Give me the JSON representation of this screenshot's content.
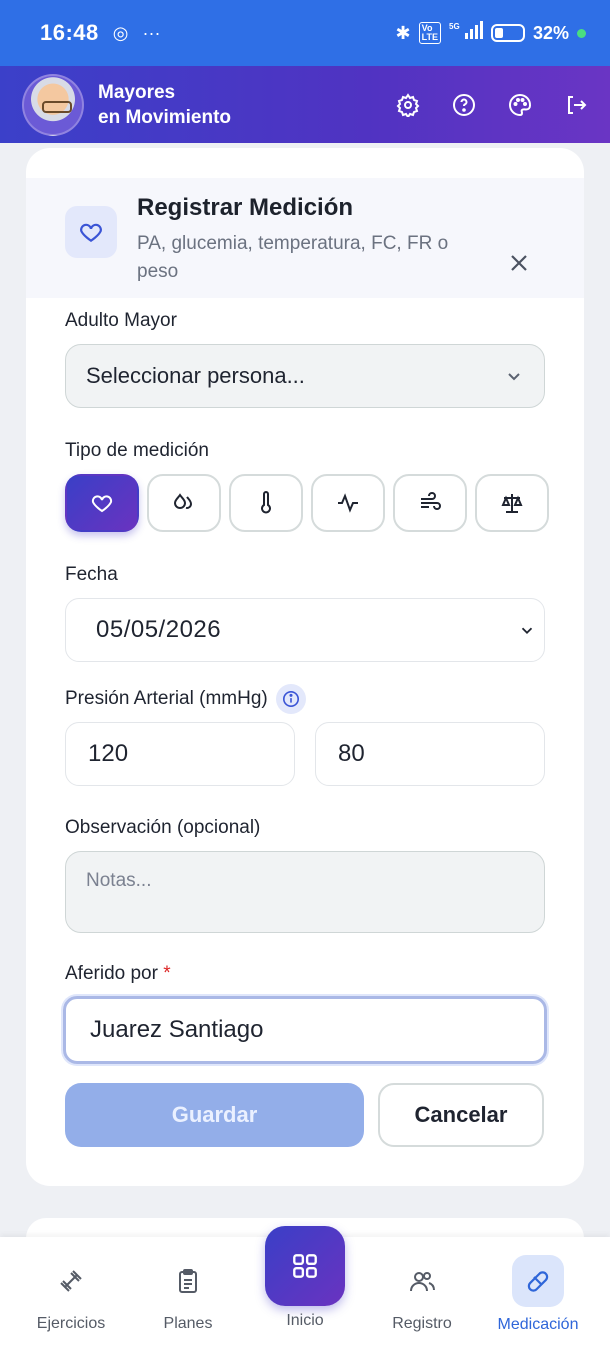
{
  "status_bar": {
    "time": "16:48",
    "battery": "32%",
    "network": "5G"
  },
  "header": {
    "brand_line1": "Mayores",
    "brand_line2": "en Movimiento"
  },
  "dialog": {
    "title": "Registrar Medición",
    "subtitle": "PA, glucemia, temperatura, FC, FR o peso",
    "adulto_label": "Adulto Mayor",
    "adulto_placeholder": "Seleccionar persona...",
    "tipo_label": "Tipo de medición",
    "types": [
      {
        "icon": "heart-icon",
        "active": true
      },
      {
        "icon": "droplet-icon",
        "active": false
      },
      {
        "icon": "thermometer-icon",
        "active": false
      },
      {
        "icon": "pulse-icon",
        "active": false
      },
      {
        "icon": "wind-icon",
        "active": false
      },
      {
        "icon": "scale-icon",
        "active": false
      }
    ],
    "fecha_label": "Fecha",
    "fecha_value": "05/05/2026",
    "presion_label": "Presión Arterial (mmHg)",
    "systolic": "120",
    "diastolic": "80",
    "obs_label": "Observación (opcional)",
    "obs_placeholder": "Notas...",
    "aferido_label": "Aferido por",
    "aferido_required": "*",
    "aferido_value": "Juarez Santiago",
    "save_label": "Guardar",
    "cancel_label": "Cancelar"
  },
  "nav": {
    "items": [
      "Ejercicios",
      "Planes",
      "Inicio",
      "Registro",
      "Medicación"
    ],
    "active": "Medicación"
  },
  "colors": {
    "primary": "#2f6fe6",
    "accent": "#5033c2",
    "active_nav": "#2f66d9"
  }
}
